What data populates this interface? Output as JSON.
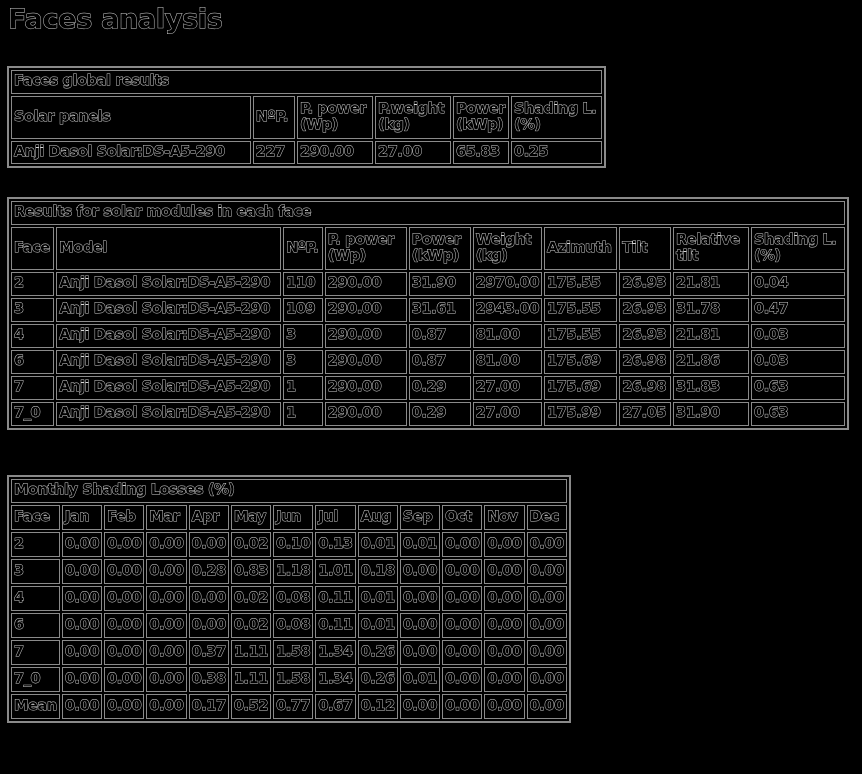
{
  "page_title": "Faces analysis",
  "global": {
    "caption": "Faces global results",
    "headers": [
      "Solar panels",
      "NºP.",
      "P. power (Wp)",
      "P.weight (kg)",
      "Power (kWp)",
      "Shading L. (%)"
    ],
    "rows": [
      [
        "Anji Dasol Solar:DS-A5-290",
        "227",
        "290.00",
        "27.00",
        "65.83",
        "0.25"
      ]
    ]
  },
  "faces": {
    "caption": "Results for solar modules in each face",
    "headers": [
      "Face",
      "Model",
      "NºP.",
      "P. power (Wp)",
      "Power (kWp)",
      "Weight (kg)",
      "Azimuth",
      "Tilt",
      "Relative tilt",
      "Shading L. (%)"
    ],
    "rows": [
      [
        "2",
        "Anji Dasol Solar:DS-A5-290",
        "110",
        "290.00",
        "31.90",
        "2970.00",
        "175.55",
        "26.93",
        "21.81",
        "0.04"
      ],
      [
        "3",
        "Anji Dasol Solar:DS-A5-290",
        "109",
        "290.00",
        "31.61",
        "2943.00",
        "175.55",
        "26.93",
        "31.78",
        "0.47"
      ],
      [
        "4",
        "Anji Dasol Solar:DS-A5-290",
        "3",
        "290.00",
        "0.87",
        "81.00",
        "175.55",
        "26.93",
        "21.81",
        "0.03"
      ],
      [
        "6",
        "Anji Dasol Solar:DS-A5-290",
        "3",
        "290.00",
        "0.87",
        "81.00",
        "175.69",
        "26.98",
        "21.86",
        "0.03"
      ],
      [
        "7",
        "Anji Dasol Solar:DS-A5-290",
        "1",
        "290.00",
        "0.29",
        "27.00",
        "175.69",
        "26.98",
        "31.83",
        "0.63"
      ],
      [
        "7_0",
        "Anji Dasol Solar:DS-A5-290",
        "1",
        "290.00",
        "0.29",
        "27.00",
        "175.99",
        "27.05",
        "31.90",
        "0.63"
      ]
    ]
  },
  "monthly": {
    "caption": "Monthly Shading Losses (%)",
    "headers": [
      "Face",
      "Jan",
      "Feb",
      "Mar",
      "Apr",
      "May",
      "Jun",
      "Jul",
      "Aug",
      "Sep",
      "Oct",
      "Nov",
      "Dec"
    ],
    "rows": [
      [
        "2",
        "0.00",
        "0.00",
        "0.00",
        "0.00",
        "0.02",
        "0.10",
        "0.13",
        "0.01",
        "0.01",
        "0.00",
        "0.00",
        "0.00"
      ],
      [
        "3",
        "0.00",
        "0.00",
        "0.00",
        "0.28",
        "0.83",
        "1.18",
        "1.01",
        "0.18",
        "0.00",
        "0.00",
        "0.00",
        "0.00"
      ],
      [
        "4",
        "0.00",
        "0.00",
        "0.00",
        "0.00",
        "0.02",
        "0.08",
        "0.11",
        "0.01",
        "0.00",
        "0.00",
        "0.00",
        "0.00"
      ],
      [
        "6",
        "0.00",
        "0.00",
        "0.00",
        "0.00",
        "0.02",
        "0.08",
        "0.11",
        "0.01",
        "0.00",
        "0.00",
        "0.00",
        "0.00"
      ],
      [
        "7",
        "0.00",
        "0.00",
        "0.00",
        "0.37",
        "1.11",
        "1.58",
        "1.34",
        "0.26",
        "0.00",
        "0.00",
        "0.00",
        "0.00"
      ],
      [
        "7_0",
        "0.00",
        "0.00",
        "0.00",
        "0.38",
        "1.11",
        "1.58",
        "1.34",
        "0.26",
        "0.01",
        "0.00",
        "0.00",
        "0.00"
      ],
      [
        "Mean",
        "0.00",
        "0.00",
        "0.00",
        "0.17",
        "0.52",
        "0.77",
        "0.67",
        "0.12",
        "0.00",
        "0.00",
        "0.00",
        "0.00"
      ]
    ]
  }
}
